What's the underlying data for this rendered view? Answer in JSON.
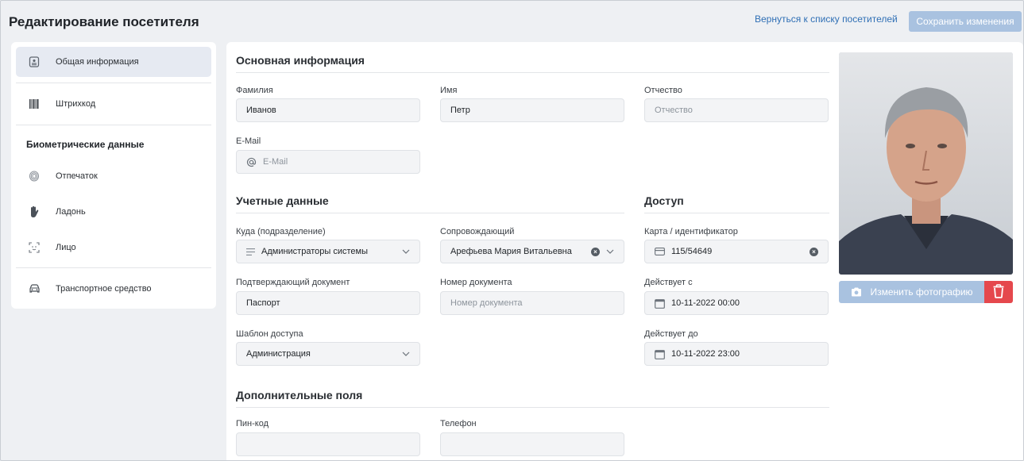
{
  "header": {
    "title": "Редактирование посетителя",
    "back_link": "Вернуться к списку посетителей",
    "save_label": "Сохранить изменения"
  },
  "sidebar": {
    "items": [
      {
        "label": "Общая информация",
        "icon": "id-card-icon",
        "active": true
      },
      {
        "label": "Штрихкод",
        "icon": "barcode-icon"
      },
      {
        "label": "Отпечаток",
        "icon": "fingerprint-icon"
      },
      {
        "label": "Ладонь",
        "icon": "palm-icon"
      },
      {
        "label": "Лицо",
        "icon": "face-scan-icon"
      },
      {
        "label": "Транспортное средство",
        "icon": "car-icon"
      }
    ],
    "biometric_heading": "Биометрические данные"
  },
  "basic": {
    "title": "Основная информация",
    "last_name": {
      "label": "Фамилия",
      "value": "Иванов"
    },
    "first_name": {
      "label": "Имя",
      "value": "Петр"
    },
    "middle_name": {
      "label": "Отчество",
      "placeholder": "Отчество"
    },
    "email": {
      "label": "E-Mail",
      "placeholder": "E-Mail"
    }
  },
  "account": {
    "title": "Учетные данные",
    "department": {
      "label": "Куда (подразделение)",
      "value": "Администраторы системы"
    },
    "escort": {
      "label": "Сопровождающий",
      "value": "Арефьева Мария Витальевна"
    },
    "document": {
      "label": "Подтверждающий документ",
      "value": "Паспорт"
    },
    "doc_number": {
      "label": "Номер документа",
      "placeholder": "Номер документа"
    },
    "template": {
      "label": "Шаблон доступа",
      "value": "Администрация"
    }
  },
  "access": {
    "title": "Доступ",
    "card": {
      "label": "Карта / идентификатор",
      "value": "115/54649"
    },
    "valid_from": {
      "label": "Действует с",
      "value": "10-11-2022 00:00"
    },
    "valid_to": {
      "label": "Действует до",
      "value": "10-11-2022 23:00"
    }
  },
  "extra": {
    "title": "Дополнительные поля",
    "pin": {
      "label": "Пин-код",
      "value": ""
    },
    "phone": {
      "label": "Телефон",
      "value": ""
    }
  },
  "photo": {
    "change_label": "Изменить фотографию"
  },
  "colors": {
    "accent_disabled": "#a9c2e0",
    "link": "#2f6fb5",
    "danger": "#e5484d"
  }
}
